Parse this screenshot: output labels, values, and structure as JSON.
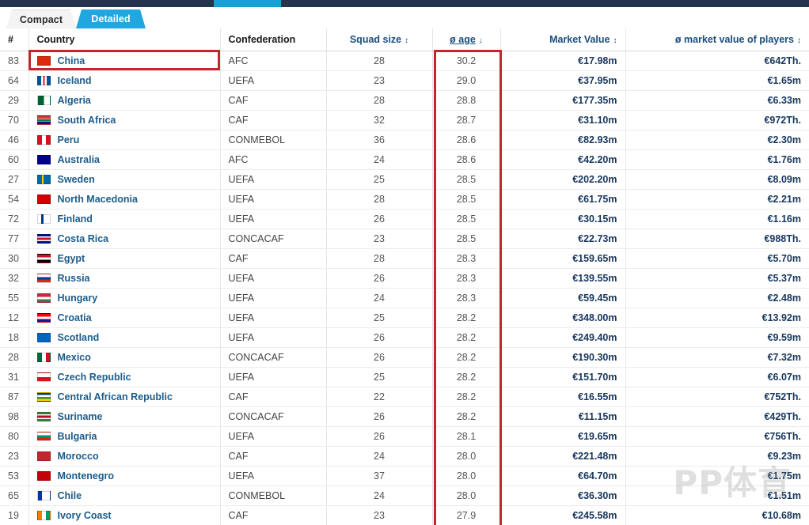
{
  "topbar": {
    "accent_color": "#17a2d6",
    "bar_color": "#24344d"
  },
  "tabs": [
    {
      "label": "Compact",
      "active": false
    },
    {
      "label": "Detailed",
      "active": true
    }
  ],
  "columns": {
    "rank": "#",
    "country": "Country",
    "confederation": "Confederation",
    "squad_size": "Squad size",
    "avg_age": "ø age",
    "market_value": "Market Value",
    "avg_market_value": "ø market value of players"
  },
  "sort": {
    "active_column": "ø age",
    "direction_icon": "↓",
    "inactive_icon": "↕"
  },
  "watermark": "PP体育",
  "annotations": [
    {
      "name": "china-row-highlight",
      "color": "#c1272d"
    },
    {
      "name": "age-column-highlight",
      "color": "#c1272d"
    }
  ],
  "rows": [
    {
      "rank": "83",
      "country": "China",
      "confederation": "AFC",
      "squad_size": "28",
      "avg_age": "30.2",
      "market_value": "€17.98m",
      "avg_market_value": "€642Th.",
      "flag": "china-flag"
    },
    {
      "rank": "64",
      "country": "Iceland",
      "confederation": "UEFA",
      "squad_size": "23",
      "avg_age": "29.0",
      "market_value": "€37.95m",
      "avg_market_value": "€1.65m",
      "flag": "iceland-flag"
    },
    {
      "rank": "29",
      "country": "Algeria",
      "confederation": "CAF",
      "squad_size": "28",
      "avg_age": "28.8",
      "market_value": "€177.35m",
      "avg_market_value": "€6.33m",
      "flag": "algeria-flag"
    },
    {
      "rank": "70",
      "country": "South Africa",
      "confederation": "CAF",
      "squad_size": "32",
      "avg_age": "28.7",
      "market_value": "€31.10m",
      "avg_market_value": "€972Th.",
      "flag": "south-africa-flag"
    },
    {
      "rank": "46",
      "country": "Peru",
      "confederation": "CONMEBOL",
      "squad_size": "36",
      "avg_age": "28.6",
      "market_value": "€82.93m",
      "avg_market_value": "€2.30m",
      "flag": "peru-flag"
    },
    {
      "rank": "60",
      "country": "Australia",
      "confederation": "AFC",
      "squad_size": "24",
      "avg_age": "28.6",
      "market_value": "€42.20m",
      "avg_market_value": "€1.76m",
      "flag": "australia-flag"
    },
    {
      "rank": "27",
      "country": "Sweden",
      "confederation": "UEFA",
      "squad_size": "25",
      "avg_age": "28.5",
      "market_value": "€202.20m",
      "avg_market_value": "€8.09m",
      "flag": "sweden-flag"
    },
    {
      "rank": "54",
      "country": "North Macedonia",
      "confederation": "UEFA",
      "squad_size": "28",
      "avg_age": "28.5",
      "market_value": "€61.75m",
      "avg_market_value": "€2.21m",
      "flag": "north-macedonia-flag"
    },
    {
      "rank": "72",
      "country": "Finland",
      "confederation": "UEFA",
      "squad_size": "26",
      "avg_age": "28.5",
      "market_value": "€30.15m",
      "avg_market_value": "€1.16m",
      "flag": "finland-flag"
    },
    {
      "rank": "77",
      "country": "Costa Rica",
      "confederation": "CONCACAF",
      "squad_size": "23",
      "avg_age": "28.5",
      "market_value": "€22.73m",
      "avg_market_value": "€988Th.",
      "flag": "costa-rica-flag"
    },
    {
      "rank": "30",
      "country": "Egypt",
      "confederation": "CAF",
      "squad_size": "28",
      "avg_age": "28.3",
      "market_value": "€159.65m",
      "avg_market_value": "€5.70m",
      "flag": "egypt-flag"
    },
    {
      "rank": "32",
      "country": "Russia",
      "confederation": "UEFA",
      "squad_size": "26",
      "avg_age": "28.3",
      "market_value": "€139.55m",
      "avg_market_value": "€5.37m",
      "flag": "russia-flag"
    },
    {
      "rank": "55",
      "country": "Hungary",
      "confederation": "UEFA",
      "squad_size": "24",
      "avg_age": "28.3",
      "market_value": "€59.45m",
      "avg_market_value": "€2.48m",
      "flag": "hungary-flag"
    },
    {
      "rank": "12",
      "country": "Croatia",
      "confederation": "UEFA",
      "squad_size": "25",
      "avg_age": "28.2",
      "market_value": "€348.00m",
      "avg_market_value": "€13.92m",
      "flag": "croatia-flag"
    },
    {
      "rank": "18",
      "country": "Scotland",
      "confederation": "UEFA",
      "squad_size": "26",
      "avg_age": "28.2",
      "market_value": "€249.40m",
      "avg_market_value": "€9.59m",
      "flag": "scotland-flag"
    },
    {
      "rank": "28",
      "country": "Mexico",
      "confederation": "CONCACAF",
      "squad_size": "26",
      "avg_age": "28.2",
      "market_value": "€190.30m",
      "avg_market_value": "€7.32m",
      "flag": "mexico-flag"
    },
    {
      "rank": "31",
      "country": "Czech Republic",
      "confederation": "UEFA",
      "squad_size": "25",
      "avg_age": "28.2",
      "market_value": "€151.70m",
      "avg_market_value": "€6.07m",
      "flag": "czech-republic-flag"
    },
    {
      "rank": "87",
      "country": "Central African Republic",
      "confederation": "CAF",
      "squad_size": "22",
      "avg_age": "28.2",
      "market_value": "€16.55m",
      "avg_market_value": "€752Th.",
      "flag": "central-african-republic-flag"
    },
    {
      "rank": "98",
      "country": "Suriname",
      "confederation": "CONCACAF",
      "squad_size": "26",
      "avg_age": "28.2",
      "market_value": "€11.15m",
      "avg_market_value": "€429Th.",
      "flag": "suriname-flag"
    },
    {
      "rank": "80",
      "country": "Bulgaria",
      "confederation": "UEFA",
      "squad_size": "26",
      "avg_age": "28.1",
      "market_value": "€19.65m",
      "avg_market_value": "€756Th.",
      "flag": "bulgaria-flag"
    },
    {
      "rank": "23",
      "country": "Morocco",
      "confederation": "CAF",
      "squad_size": "24",
      "avg_age": "28.0",
      "market_value": "€221.48m",
      "avg_market_value": "€9.23m",
      "flag": "morocco-flag"
    },
    {
      "rank": "53",
      "country": "Montenegro",
      "confederation": "UEFA",
      "squad_size": "37",
      "avg_age": "28.0",
      "market_value": "€64.70m",
      "avg_market_value": "€1.75m",
      "flag": "montenegro-flag"
    },
    {
      "rank": "65",
      "country": "Chile",
      "confederation": "CONMEBOL",
      "squad_size": "24",
      "avg_age": "28.0",
      "market_value": "€36.30m",
      "avg_market_value": "€1.51m",
      "flag": "chile-flag"
    },
    {
      "rank": "19",
      "country": "Ivory Coast",
      "confederation": "CAF",
      "squad_size": "23",
      "avg_age": "27.9",
      "market_value": "€245.58m",
      "avg_market_value": "€10.68m",
      "flag": "ivory-coast-flag"
    }
  ]
}
